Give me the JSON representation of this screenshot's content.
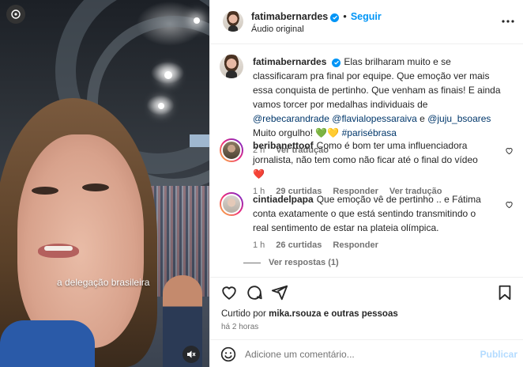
{
  "video": {
    "caption": "a delegação brasileira",
    "mute_icon": "speaker-muted-icon"
  },
  "header": {
    "username": "fatimabernardes",
    "separator": "•",
    "follow_label": "Seguir",
    "audio_label": "Áudio original",
    "more_icon": "more-horizontal-icon"
  },
  "post": {
    "username": "fatimabernardes",
    "text_1": "Elas brilharam muito e se classificaram pra final por equipe. Que emoção ver mais essa conquista de pertinho. Que venham as finais! E ainda vamos torcer por medalhas individuais de ",
    "mention_1": "@rebecarandrade",
    "mention_2": "@flavialopessaraiva",
    "text_2": " e ",
    "mention_3": "@juju_bsoares",
    "text_3": " Muito orgulho! 💚💛 ",
    "hashtag": "#parisébrasa",
    "time": "2 h",
    "translate": "Ver tradução"
  },
  "comments": [
    {
      "username": "beribanettoof",
      "text": "Como é bom ter uma influenciadora jornalista, não tem como não ficar até o final do vídeo ❤️",
      "time": "1 h",
      "likes": "29 curtidas",
      "reply": "Responder",
      "translate": "Ver tradução"
    },
    {
      "username": "cintiadelpapa",
      "text": "Que emoção vê de pertinho .. e Fátima conta exatamente o que está sentindo transmitindo o real sentimento de estar na plateia olímpica.",
      "time": "1 h",
      "likes": "26 curtidas",
      "reply": "Responder",
      "view_replies": "Ver respostas (1)"
    }
  ],
  "actions": {
    "liked_by_prefix": "Curtido por ",
    "liked_by_user": "mika.rsouza",
    "liked_by_suffix": " e outras pessoas",
    "timestamp": "há 2 horas"
  },
  "composer": {
    "placeholder": "Adicione um comentário...",
    "post_label": "Publicar"
  },
  "colors": {
    "accent": "#0095f6",
    "mention": "#00376b",
    "muted": "#737373",
    "disabled_post": "#b3dbff"
  }
}
